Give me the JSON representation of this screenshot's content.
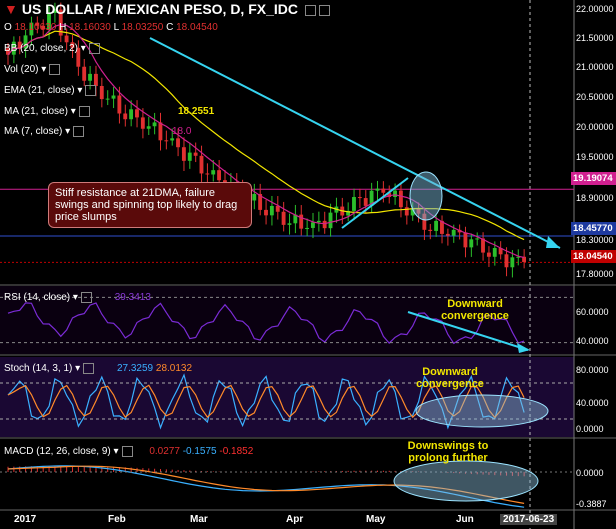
{
  "header": {
    "title": "US DOLLAR / MEXICAN PESO, D, FX_IDC",
    "ohlc": [
      {
        "k": "O",
        "v": "18.10630"
      },
      {
        "k": "H",
        "v": "18.16030"
      },
      {
        "k": "L",
        "v": "18.03250"
      },
      {
        "k": "C",
        "v": "18.04540"
      }
    ]
  },
  "indicators": {
    "bb": "BB (20, close, 2)",
    "vol": "Vol (20)",
    "ema": "EMA (21, close)",
    "ma21": "MA (21, close)",
    "ma7": "MA (7, close)",
    "ma21_value": "18.2551",
    "ma7_value": "18.0"
  },
  "price_axis": {
    "ticks": [
      "22.00000",
      "21.50000",
      "21.00000",
      "20.50000",
      "20.00000",
      "19.50000",
      "18.90000",
      "18.30000",
      "17.80000"
    ],
    "tags": [
      {
        "label": "19.19074",
        "color": "#d02090"
      },
      {
        "label": "18.45770",
        "color": "#1e3aa0"
      },
      {
        "label": "18.04540",
        "color": "#c00000"
      }
    ]
  },
  "rsi": {
    "label": "RSI (14, close)",
    "value": "39.3413",
    "ticks": [
      "60.0000",
      "40.0000"
    ]
  },
  "stoch": {
    "label": "Stoch (14, 3, 1)",
    "k_value": "27.3259",
    "d_value": "28.0132",
    "ticks": [
      "80.0000",
      "40.0000",
      "0.0000"
    ]
  },
  "macd": {
    "label": "MACD (12, 26, close, 9)",
    "v1": "0.0277",
    "v2": "-0.1575",
    "v3": "-0.1852",
    "ticks": [
      "0.0000",
      "-0.3887"
    ]
  },
  "x_axis": {
    "ticks": [
      "2017",
      "Feb",
      "Mar",
      "Apr",
      "May",
      "Jun"
    ],
    "current_date": "2017-06-23"
  },
  "annotations": {
    "resistance_note": "Stiff resistance at 21DMA, failure swings and spinning top likely to drag price slumps",
    "rsi_note": "Downward convergence",
    "stoch_note": "Downward convergence",
    "macd_note": "Downswings to prolong further"
  },
  "chart_data": {
    "type": "candlestick",
    "title": "US DOLLAR / MEXICAN PESO, D, FX_IDC",
    "x": [
      "2017-01",
      "2017-02",
      "2017-03",
      "2017-04",
      "2017-05",
      "2017-06"
    ],
    "close_series": [
      21.3,
      21.7,
      21.9,
      21.1,
      20.7,
      20.4,
      20.2,
      19.9,
      19.6,
      19.3,
      19.1,
      18.9,
      18.7,
      18.6,
      18.8,
      19.0,
      19.2,
      18.9,
      18.6,
      18.5,
      18.3,
      18.1,
      18.05
    ],
    "ylim": [
      17.8,
      22.0
    ],
    "levels": {
      "resistance_21dma": 19.19074,
      "support": 18.4577,
      "last": 18.0454
    },
    "colors": {
      "up": "#2bbf2b",
      "down": "#e03030",
      "trendline": "#36d4f0"
    }
  }
}
